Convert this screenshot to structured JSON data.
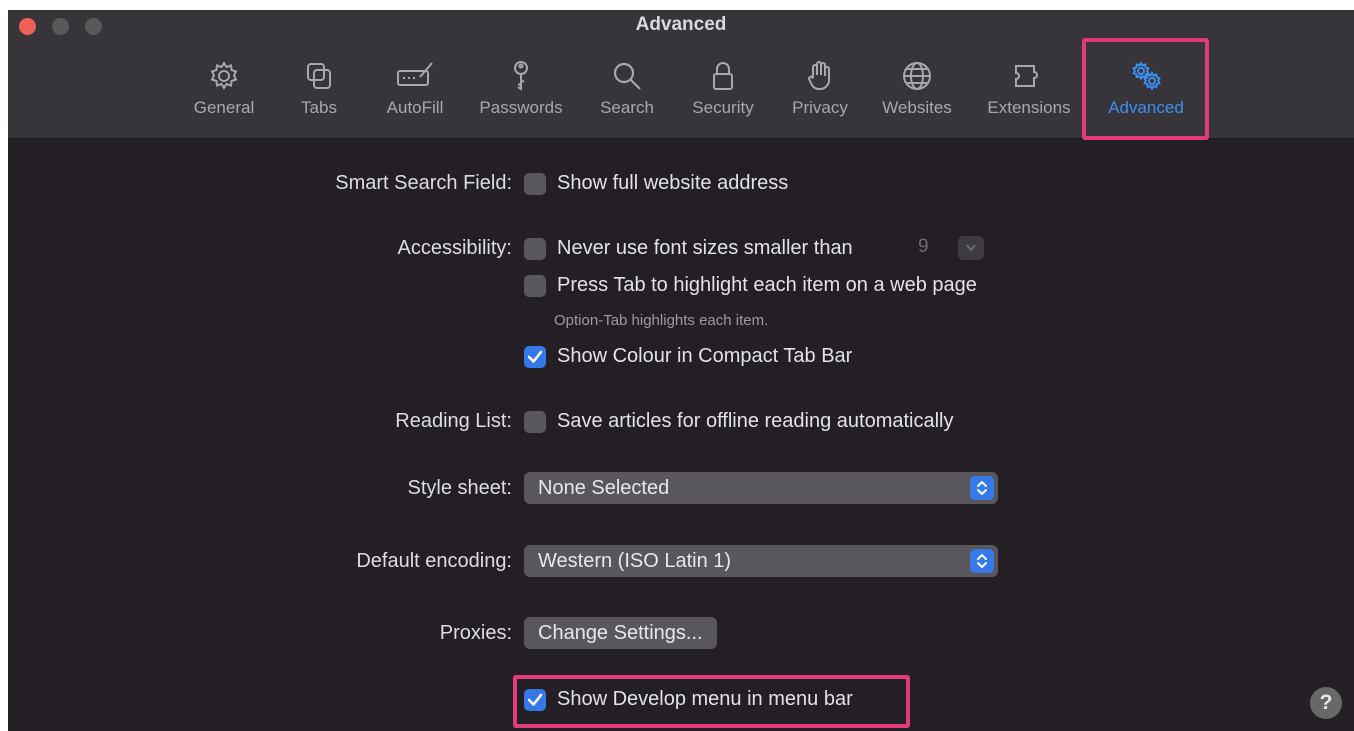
{
  "window": {
    "title": "Advanced"
  },
  "toolbar": {
    "tabs": [
      {
        "label": "General",
        "icon": "gear-icon"
      },
      {
        "label": "Tabs",
        "icon": "tabs-icon"
      },
      {
        "label": "AutoFill",
        "icon": "autofill-icon"
      },
      {
        "label": "Passwords",
        "icon": "key-icon"
      },
      {
        "label": "Search",
        "icon": "search-icon"
      },
      {
        "label": "Security",
        "icon": "lock-icon"
      },
      {
        "label": "Privacy",
        "icon": "hand-icon"
      },
      {
        "label": "Websites",
        "icon": "globe-icon"
      },
      {
        "label": "Extensions",
        "icon": "puzzle-icon"
      },
      {
        "label": "Advanced",
        "icon": "gears-icon",
        "active": true
      }
    ]
  },
  "settings": {
    "smart_search": {
      "label": "Smart Search Field:",
      "option": "Show full website address",
      "checked": false
    },
    "accessibility": {
      "label": "Accessibility:",
      "min_font": {
        "option": "Never use font sizes smaller than",
        "checked": false,
        "size": "9"
      },
      "press_tab": {
        "option": "Press Tab to highlight each item on a web page",
        "checked": false,
        "hint": "Option-Tab highlights each item."
      },
      "show_colour": {
        "option": "Show Colour in Compact Tab Bar",
        "checked": true
      }
    },
    "reading_list": {
      "label": "Reading List:",
      "option": "Save articles for offline reading automatically",
      "checked": false
    },
    "style_sheet": {
      "label": "Style sheet:",
      "value": "None Selected"
    },
    "default_encoding": {
      "label": "Default encoding:",
      "value": "Western (ISO Latin 1)"
    },
    "proxies": {
      "label": "Proxies:",
      "button": "Change Settings..."
    },
    "develop_menu": {
      "option": "Show Develop menu in menu bar",
      "checked": true
    }
  },
  "help": {
    "label": "?"
  },
  "colors": {
    "accent": "#3579e8",
    "highlight": "#e23c78",
    "background": "#231f25",
    "toolbar": "#38353a"
  }
}
